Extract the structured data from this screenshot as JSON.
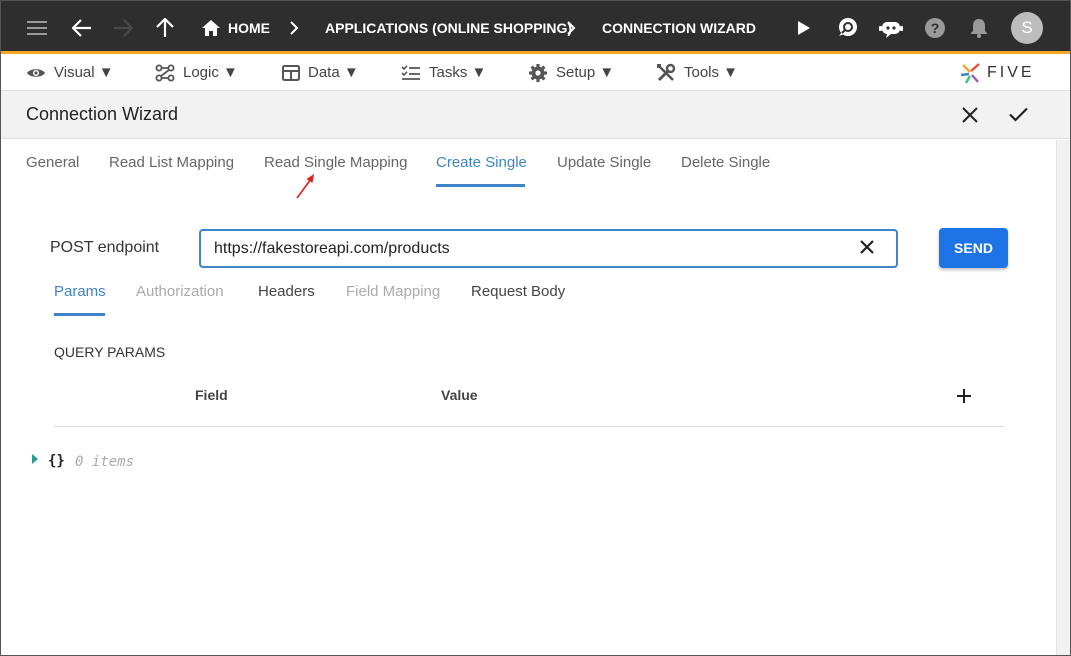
{
  "topbar": {
    "breadcrumbs": [
      {
        "label": "HOME"
      },
      {
        "label": "APPLICATIONS (ONLINE SHOPPING)"
      },
      {
        "label": "CONNECTION WIZARD"
      }
    ],
    "avatar_initial": "S",
    "accent_color": "#f5a623",
    "icons": [
      "menu-icon",
      "back-arrow-icon",
      "forward-arrow-icon",
      "up-arrow-icon",
      "home-icon",
      "play-icon",
      "search-chat-icon",
      "chat-bot-icon",
      "help-icon",
      "bell-icon"
    ]
  },
  "menubar": {
    "items": [
      {
        "label": "Visual ▼",
        "icon": "eye-icon"
      },
      {
        "label": "Logic ▼",
        "icon": "flow-icon"
      },
      {
        "label": "Data ▼",
        "icon": "table-icon"
      },
      {
        "label": "Tasks ▼",
        "icon": "checklist-icon"
      },
      {
        "label": "Setup ▼",
        "icon": "gear-icon"
      },
      {
        "label": "Tools ▼",
        "icon": "tools-icon"
      }
    ],
    "logo_text": "FIVE"
  },
  "header": {
    "title": "Connection Wizard"
  },
  "tabs": {
    "items": [
      {
        "label": "General"
      },
      {
        "label": "Read List Mapping"
      },
      {
        "label": "Read Single Mapping"
      },
      {
        "label": "Create Single"
      },
      {
        "label": "Update Single"
      },
      {
        "label": "Delete Single"
      }
    ],
    "active": "Create Single"
  },
  "endpoint": {
    "label": "POST endpoint",
    "value": "https://fakestoreapi.com/products",
    "send_label": "SEND"
  },
  "subtabs": {
    "items": [
      {
        "label": "Params"
      },
      {
        "label": "Authorization"
      },
      {
        "label": "Headers"
      },
      {
        "label": "Field Mapping"
      },
      {
        "label": "Request Body"
      }
    ],
    "active": "Params"
  },
  "query_params": {
    "title": "QUERY PARAMS",
    "columns": [
      "Field",
      "Value"
    ]
  },
  "json_viewer": {
    "brace": "{}",
    "count_text": "0 items"
  }
}
